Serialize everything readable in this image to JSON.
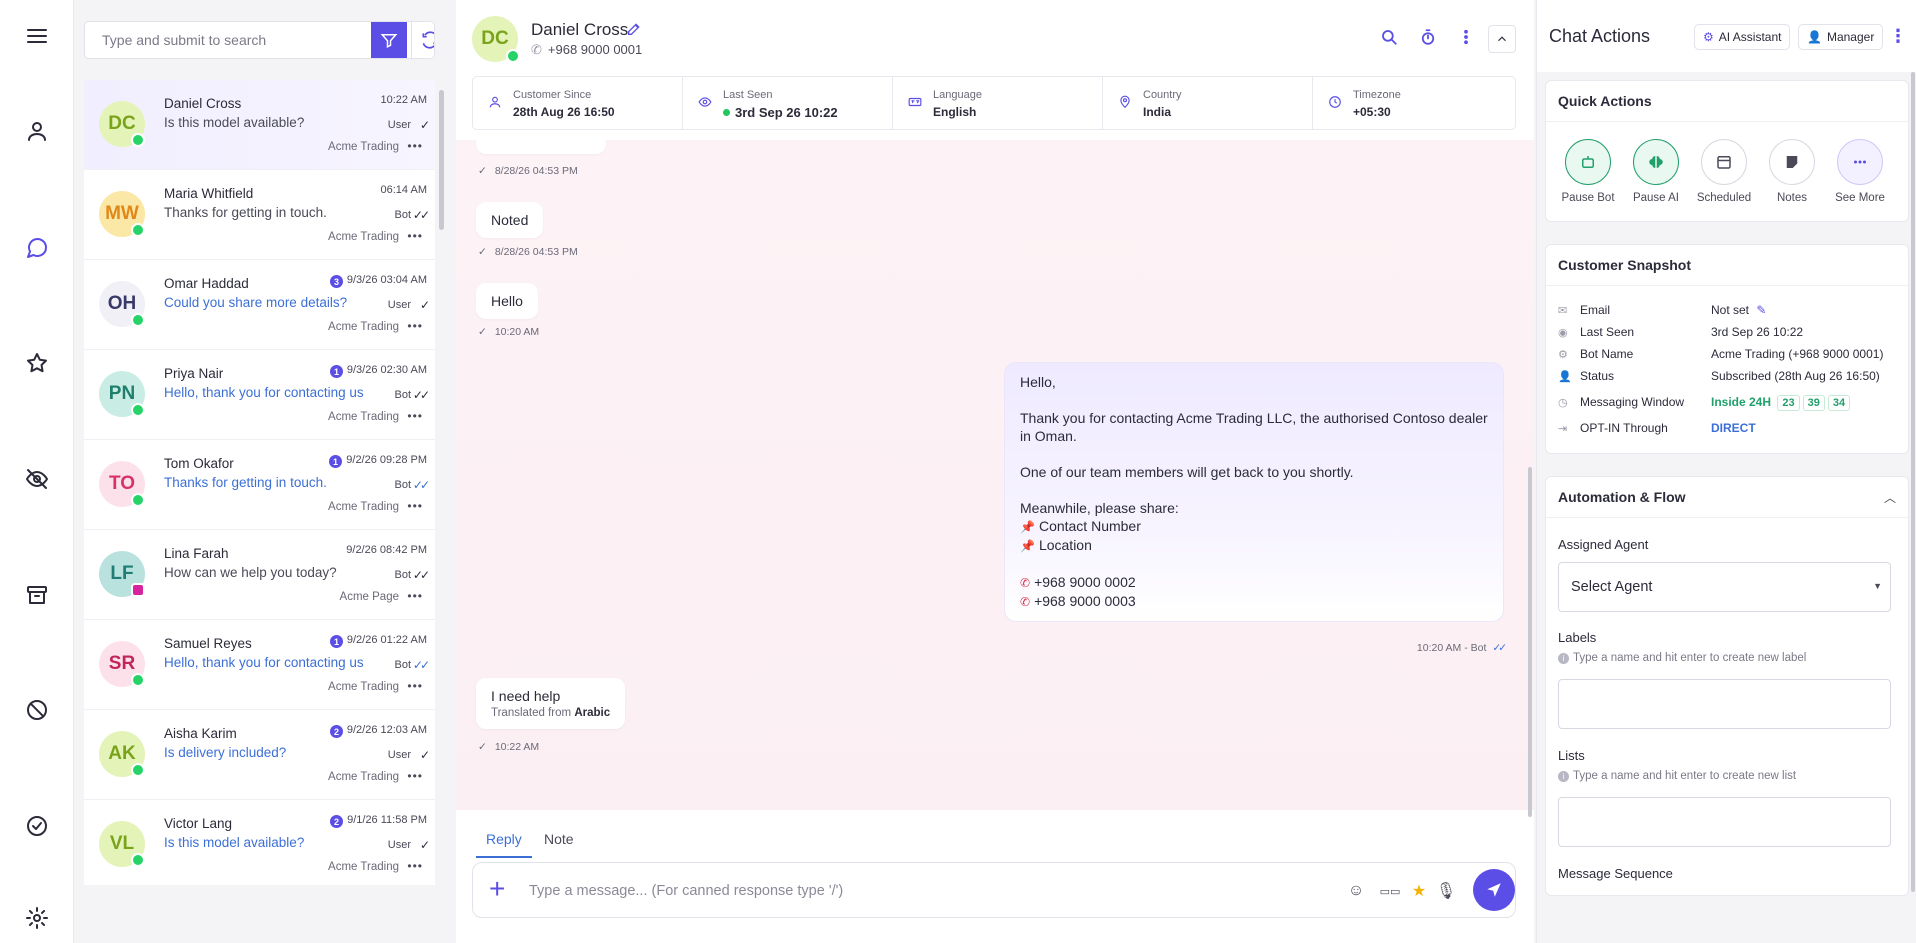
{
  "search": {
    "placeholder": "Type and submit to search"
  },
  "rail": {
    "items": [
      "menu-icon",
      "contacts-icon",
      "chat-icon",
      "star-icon",
      "hidden-icon",
      "archive-icon",
      "blocked-icon",
      "resolved-icon",
      "settings-icon"
    ],
    "active": "chat-icon"
  },
  "conversations": [
    {
      "initials": "DC",
      "name": "Daniel Cross",
      "preview": "Is this model available?",
      "time": "10:22 AM",
      "unread": "",
      "sender": "User",
      "account": "Acme Trading",
      "channel": "whatsapp",
      "check": "✓",
      "check_blue": false,
      "preview_unread": false,
      "avatar_bg": "#e4f3b8",
      "avatar_fg": "#7aa31c"
    },
    {
      "initials": "MW",
      "name": "Maria Whitfield",
      "preview": "Thanks for getting in touch.",
      "time": "06:14 AM",
      "unread": "",
      "sender": "Bot",
      "account": "Acme Trading",
      "channel": "whatsapp",
      "check": "✓✓",
      "check_blue": false,
      "preview_unread": false,
      "avatar_bg": "#fbe7a6",
      "avatar_fg": "#e0881a"
    },
    {
      "initials": "OH",
      "name": "Omar Haddad",
      "preview": "Could you share more details?",
      "time": "9/3/26 03:04 AM",
      "unread": "3",
      "sender": "User",
      "account": "Acme Trading",
      "channel": "whatsapp",
      "check": "✓",
      "check_blue": false,
      "preview_unread": true,
      "avatar_bg": "#f1f0f6",
      "avatar_fg": "#3a3a6a"
    },
    {
      "initials": "PN",
      "name": "Priya Nair",
      "preview": "Hello, thank you for contacting us!",
      "time": "9/3/26 02:30 AM",
      "unread": "1",
      "sender": "Bot",
      "account": "Acme Trading",
      "channel": "whatsapp",
      "check": "✓✓",
      "check_blue": false,
      "preview_unread": true,
      "avatar_bg": "#c9ede5",
      "avatar_fg": "#1e7f6d"
    },
    {
      "initials": "TO",
      "name": "Tom Okafor",
      "preview": "Thanks for getting in touch.",
      "time": "9/2/26 09:28 PM",
      "unread": "1",
      "sender": "Bot",
      "account": "Acme Trading",
      "channel": "whatsapp",
      "check": "✓✓",
      "check_blue": true,
      "preview_unread": true,
      "avatar_bg": "#fde1ea",
      "avatar_fg": "#d6336c"
    },
    {
      "initials": "LF",
      "name": "Lina Farah",
      "preview": "How can we help you today?",
      "time": "9/2/26 08:42 PM",
      "unread": "",
      "sender": "Bot",
      "account": "Acme Page",
      "channel": "instagram",
      "check": "✓✓",
      "check_blue": false,
      "preview_unread": false,
      "avatar_bg": "#b9e1de",
      "avatar_fg": "#1f7d75"
    },
    {
      "initials": "SR",
      "name": "Samuel Reyes",
      "preview": "Hello, thank you for contacting us!",
      "time": "9/2/26 01:22 AM",
      "unread": "1",
      "sender": "Bot",
      "account": "Acme Trading",
      "channel": "whatsapp",
      "check": "✓✓",
      "check_blue": true,
      "preview_unread": true,
      "avatar_bg": "#fde1ea",
      "avatar_fg": "#c2255c"
    },
    {
      "initials": "AK",
      "name": "Aisha Karim",
      "preview": "Is delivery included?",
      "time": "9/2/26 12:03 AM",
      "unread": "2",
      "sender": "User",
      "account": "Acme Trading",
      "channel": "whatsapp",
      "check": "✓",
      "check_blue": false,
      "preview_unread": true,
      "avatar_bg": "#e4f3b8",
      "avatar_fg": "#7aa31c"
    },
    {
      "initials": "VL",
      "name": "Victor Lang",
      "preview": "Is this model available?",
      "time": "9/1/26 11:58 PM",
      "unread": "2",
      "sender": "User",
      "account": "Acme Trading",
      "channel": "whatsapp",
      "check": "✓",
      "check_blue": false,
      "preview_unread": true,
      "avatar_bg": "#e4f3b8",
      "avatar_fg": "#7aa31c"
    }
  ],
  "chat": {
    "initials": "DC",
    "name": "Daniel Cross",
    "phone": "+968 9000 0001",
    "info": {
      "customer_since_label": "Customer Since",
      "customer_since": "28th Aug 26 16:50",
      "last_seen_label": "Last Seen",
      "last_seen": "3rd Sep 26 10:22",
      "language_label": "Language",
      "language": "English",
      "country_label": "Country",
      "country": "India",
      "timezone_label": "Timezone",
      "timezone": "+05:30"
    },
    "messages": {
      "m1_meta": "8/28/26 04:53 PM",
      "m2_text": "Noted",
      "m2_meta": "8/28/26 04:53 PM",
      "m3_text": "Hello",
      "m3_meta": "10:20 AM",
      "out_greeting": "Hello,",
      "out_p1": "Thank you for contacting Acme Trading LLC, the authorised Contoso dealer in Oman.",
      "out_p2": "One of our team members will get back to you shortly.",
      "out_p3": "Meanwhile, please share:",
      "out_item1": "Contact Number",
      "out_item2": "Location",
      "out_phone1": "+968 9000 0002",
      "out_phone2": "+968 9000 0003",
      "out_meta": "10:20 AM - Bot",
      "m5_text": "I need help",
      "m5_translated_prefix": "Translated from",
      "m5_translated_lang": "Arabic",
      "m5_meta": "10:22 AM"
    },
    "tabs": {
      "reply": "Reply",
      "note": "Note"
    },
    "composer_placeholder": "Type a message... (For canned response type '/')"
  },
  "right": {
    "title": "Chat Actions",
    "ai_assistant": "AI Assistant",
    "manager": "Manager",
    "quick_actions_title": "Quick Actions",
    "quick_actions": [
      {
        "label": "Pause Bot",
        "icon": "robot-icon"
      },
      {
        "label": "Pause AI",
        "icon": "brain-icon"
      },
      {
        "label": "Scheduled",
        "icon": "calendar-icon"
      },
      {
        "label": "Notes",
        "icon": "note-icon"
      },
      {
        "label": "See More",
        "icon": "more-icon"
      }
    ],
    "snapshot_title": "Customer Snapshot",
    "snapshot": {
      "email_label": "Email",
      "email": "Not set",
      "last_seen_label": "Last Seen",
      "last_seen": "3rd Sep 26 10:22",
      "bot_name_label": "Bot Name",
      "bot_name": "Acme Trading (+968 9000 0001)",
      "status_label": "Status",
      "status": "Subscribed (28th Aug 26 16:50)",
      "window_label": "Messaging Window",
      "window": "Inside 24H",
      "win_h": "23",
      "win_m": "39",
      "win_s": "34",
      "optin_label": "OPT-IN Through",
      "optin": "DIRECT"
    },
    "automation_title": "Automation & Flow",
    "assigned_agent_label": "Assigned Agent",
    "assigned_agent_value": "Select Agent",
    "labels_label": "Labels",
    "labels_hint": "Type a name and hit enter to create new label",
    "lists_label": "Lists",
    "lists_hint": "Type a name and hit enter to create new list",
    "sequence_label": "Message Sequence"
  },
  "colors": {
    "accent": "#5b4ee6",
    "link_blue": "#3b6fd6",
    "whatsapp": "#25d366",
    "success": "#22a06b"
  }
}
